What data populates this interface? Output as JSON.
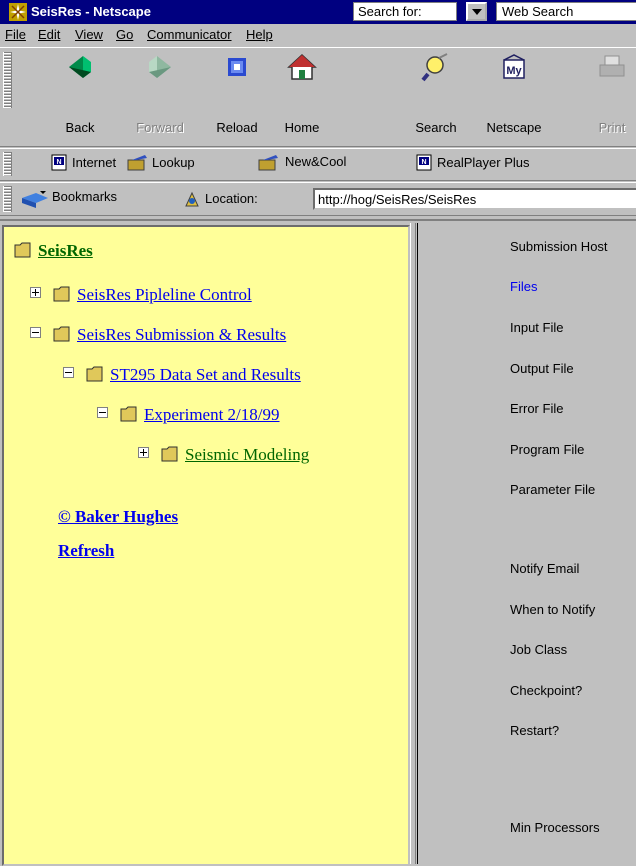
{
  "window": {
    "title": "SeisRes - Netscape"
  },
  "titlebar": {
    "search_label": "Search for:",
    "search_engine": "Web Search"
  },
  "menu": [
    "File",
    "Edit",
    "View",
    "Go",
    "Communicator",
    "Help"
  ],
  "nav_toolbar": {
    "buttons": [
      {
        "label": "Back",
        "icon": "back-arrow-icon",
        "enabled": true
      },
      {
        "label": "Forward",
        "icon": "forward-arrow-icon",
        "enabled": false
      },
      {
        "label": "Reload",
        "icon": "reload-icon",
        "enabled": true
      },
      {
        "label": "Home",
        "icon": "home-icon",
        "enabled": true
      },
      {
        "label": "Search",
        "icon": "search-icon",
        "enabled": true
      },
      {
        "label": "Netscape",
        "icon": "netscape-icon",
        "enabled": true
      },
      {
        "label": "Print",
        "icon": "print-icon",
        "enabled": false
      }
    ]
  },
  "personal_toolbar": {
    "items": [
      {
        "label": "Internet",
        "icon": "bookmark-page-icon"
      },
      {
        "label": "Lookup",
        "icon": "folder-bookmark-icon"
      },
      {
        "label": "New&Cool",
        "icon": "folder-bookmark-icon"
      },
      {
        "label": "RealPlayer Plus",
        "icon": "bookmark-page-icon"
      }
    ]
  },
  "location_bar": {
    "bookmarks_label": "Bookmarks",
    "location_label": "Location:",
    "url": "http://hog/SeisRes/SeisRes"
  },
  "tree": {
    "root": "SeisRes",
    "nodes": [
      {
        "label": "SeisRes Pipleline Control",
        "level": 0,
        "state": "collapsed"
      },
      {
        "label": "SeisRes Submission & Results",
        "level": 0,
        "state": "expanded"
      },
      {
        "label": "ST295 Data Set and Results",
        "level": 1,
        "state": "expanded"
      },
      {
        "label": "Experiment 2/18/99",
        "level": 2,
        "state": "expanded"
      },
      {
        "label": "Seismic Modeling",
        "level": 3,
        "state": "collapsed"
      }
    ],
    "copyright": "© Baker Hughes",
    "refresh": "Refresh"
  },
  "form_labels": {
    "submission_host": "Submission Host",
    "files": "Files",
    "input_file": "Input File",
    "output_file": "Output File",
    "error_file": "Error File",
    "program_file": "Program File",
    "parameter_file": "Parameter File",
    "notify_email": "Notify Email",
    "when_to_notify": "When to Notify",
    "job_class": "Job Class",
    "checkpoint": "Checkpoint?",
    "restart": "Restart?",
    "min_processors": "Min Processors"
  },
  "colors": {
    "titlebar": "#000080",
    "chrome": "#c0c0c0",
    "tree_background": "#ffff99",
    "link": "#0000ee",
    "visited_link": "#006600"
  }
}
